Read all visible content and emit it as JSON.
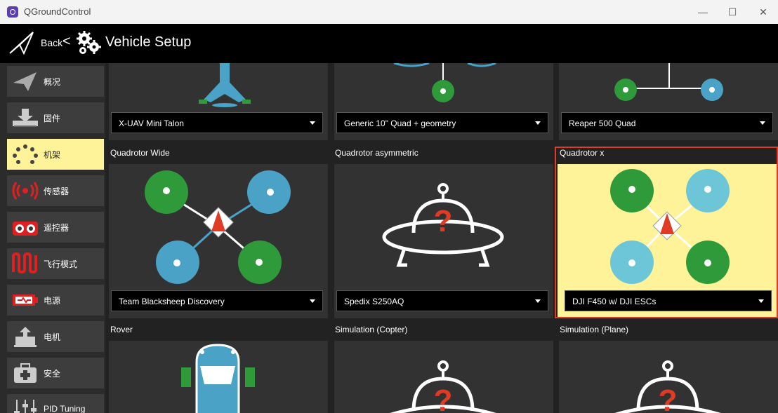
{
  "window": {
    "title": "QGroundControl",
    "controls": {
      "minimize": "—",
      "maximize": "☐",
      "close": "✕"
    }
  },
  "toolbar": {
    "back_label": "Back",
    "separator": "<",
    "title": "Vehicle Setup"
  },
  "sidebar": {
    "items": [
      {
        "label": "概况",
        "icon": "paper-plane-icon"
      },
      {
        "label": "固件",
        "icon": "download-icon"
      },
      {
        "label": "机架",
        "icon": "frame-dots-icon",
        "active": true
      },
      {
        "label": "传感器",
        "icon": "radio-waves-icon"
      },
      {
        "label": "遥控器",
        "icon": "transmitter-icon"
      },
      {
        "label": "飞行模式",
        "icon": "waveform-icon"
      },
      {
        "label": "电源",
        "icon": "battery-icon"
      },
      {
        "label": "电机",
        "icon": "motor-icon"
      },
      {
        "label": "安全",
        "icon": "first-aid-icon"
      },
      {
        "label": "PID Tuning",
        "icon": "sliders-icon"
      }
    ]
  },
  "frames": {
    "row1": [
      {
        "selected": "X-UAV Mini Talon"
      },
      {
        "selected": "Generic 10\" Quad + geometry"
      },
      {
        "selected": "Reaper 500 Quad"
      }
    ],
    "row2": [
      {
        "category": "Quadrotor Wide",
        "selected": "Team Blacksheep Discovery"
      },
      {
        "category": "Quadrotor asymmetric",
        "selected": "Spedix S250AQ"
      },
      {
        "category": "Quadrotor x",
        "selected": "DJI F450 w/ DJI ESCs",
        "active": true
      }
    ],
    "row3": [
      {
        "category": "Rover"
      },
      {
        "category": "Simulation (Copter)"
      },
      {
        "category": "Simulation (Plane)"
      }
    ]
  },
  "colors": {
    "selected_bg": "#fff39a",
    "selected_border": "#e03b24",
    "motor_green": "#2e9a3a",
    "motor_blue": "#4aa3c7",
    "arrow_red": "#e03b24"
  }
}
